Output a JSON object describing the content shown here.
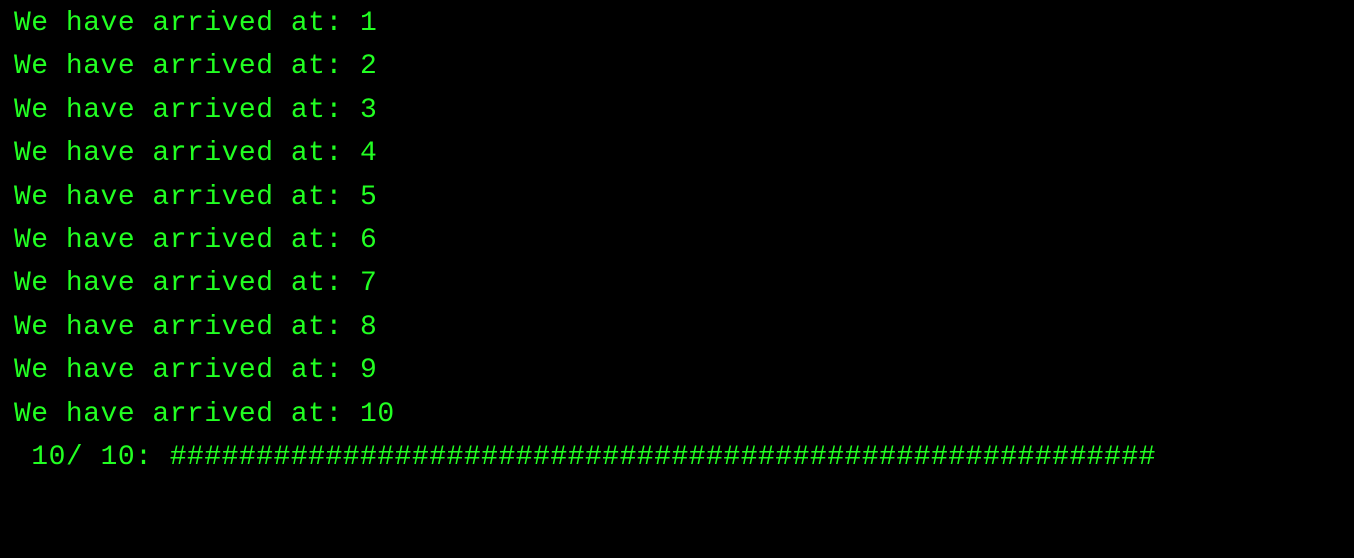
{
  "terminal": {
    "message_prefix": "We have arrived at: ",
    "lines": [
      {
        "text": "We have arrived at: 1"
      },
      {
        "text": "We have arrived at: 2"
      },
      {
        "text": "We have arrived at: 3"
      },
      {
        "text": "We have arrived at: 4"
      },
      {
        "text": "We have arrived at: 5"
      },
      {
        "text": "We have arrived at: 6"
      },
      {
        "text": "We have arrived at: 7"
      },
      {
        "text": "We have arrived at: 8"
      },
      {
        "text": "We have arrived at: 9"
      },
      {
        "text": "We have arrived at: 10"
      }
    ],
    "progress": {
      "current": 10,
      "total": 10,
      "bar_char": "#",
      "bar_length": 57,
      "text": " 10/ 10: #########################################################"
    }
  }
}
